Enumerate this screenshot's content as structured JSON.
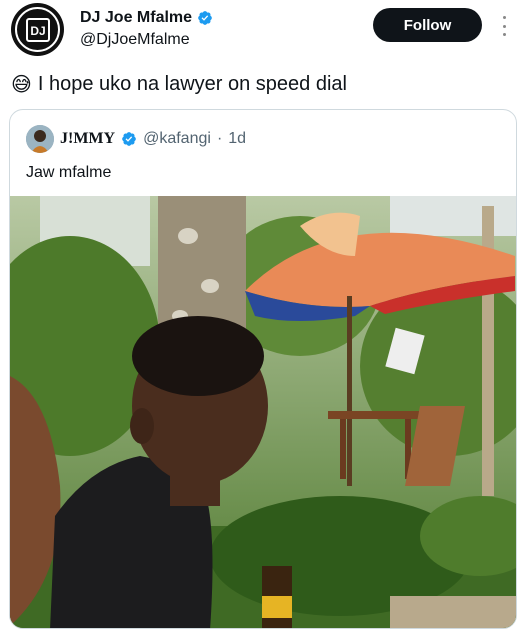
{
  "author": {
    "display_name": "DJ Joe Mfalme",
    "handle": "@DjJoeMfalme",
    "avatar_text": "DJ",
    "verified": true
  },
  "actions": {
    "follow_label": "Follow"
  },
  "tweet": {
    "emoji": "😅",
    "text": "I hope uko na lawyer on speed dial"
  },
  "quoted": {
    "display_name": "J!MMY",
    "handle": "@kafangi",
    "separator": "·",
    "time": "1d",
    "text": "Jaw mfalme",
    "verified": true
  },
  "colors": {
    "verified_blue": "#1d9bf0",
    "follow_bg": "#0f1419",
    "secondary_text": "#536471",
    "border": "#cfd9de"
  },
  "icons": {
    "verified": "verified-badge-icon",
    "more": "more-options-icon"
  }
}
